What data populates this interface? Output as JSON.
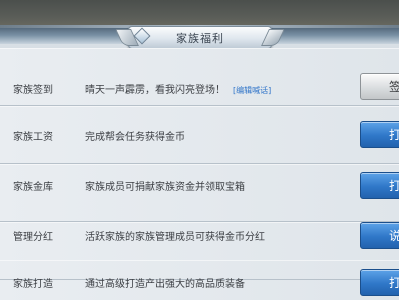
{
  "header": {
    "title": "家族福利"
  },
  "welfare_rows": [
    {
      "name": "家族签到",
      "desc": "晴天一声霹雳，看我闪亮登场！",
      "link": "[编辑喊话]",
      "button": "签",
      "button_style": "grey"
    },
    {
      "name": "家族工资",
      "desc": "完成帮会任务获得金币",
      "button": "打",
      "button_style": "blue"
    },
    {
      "name": "家族金库",
      "desc": "家族成员可捐献家族资金并领取宝箱",
      "button": "打",
      "button_style": "blue"
    },
    {
      "name": "管理分红",
      "desc": "活跃家族的家族管理成员可获得金币分红",
      "button": "说",
      "button_style": "blue"
    },
    {
      "name": "家族打造",
      "desc": "通过高级打造产出强大的高品质装备",
      "button": "打",
      "button_style": "blue"
    }
  ]
}
